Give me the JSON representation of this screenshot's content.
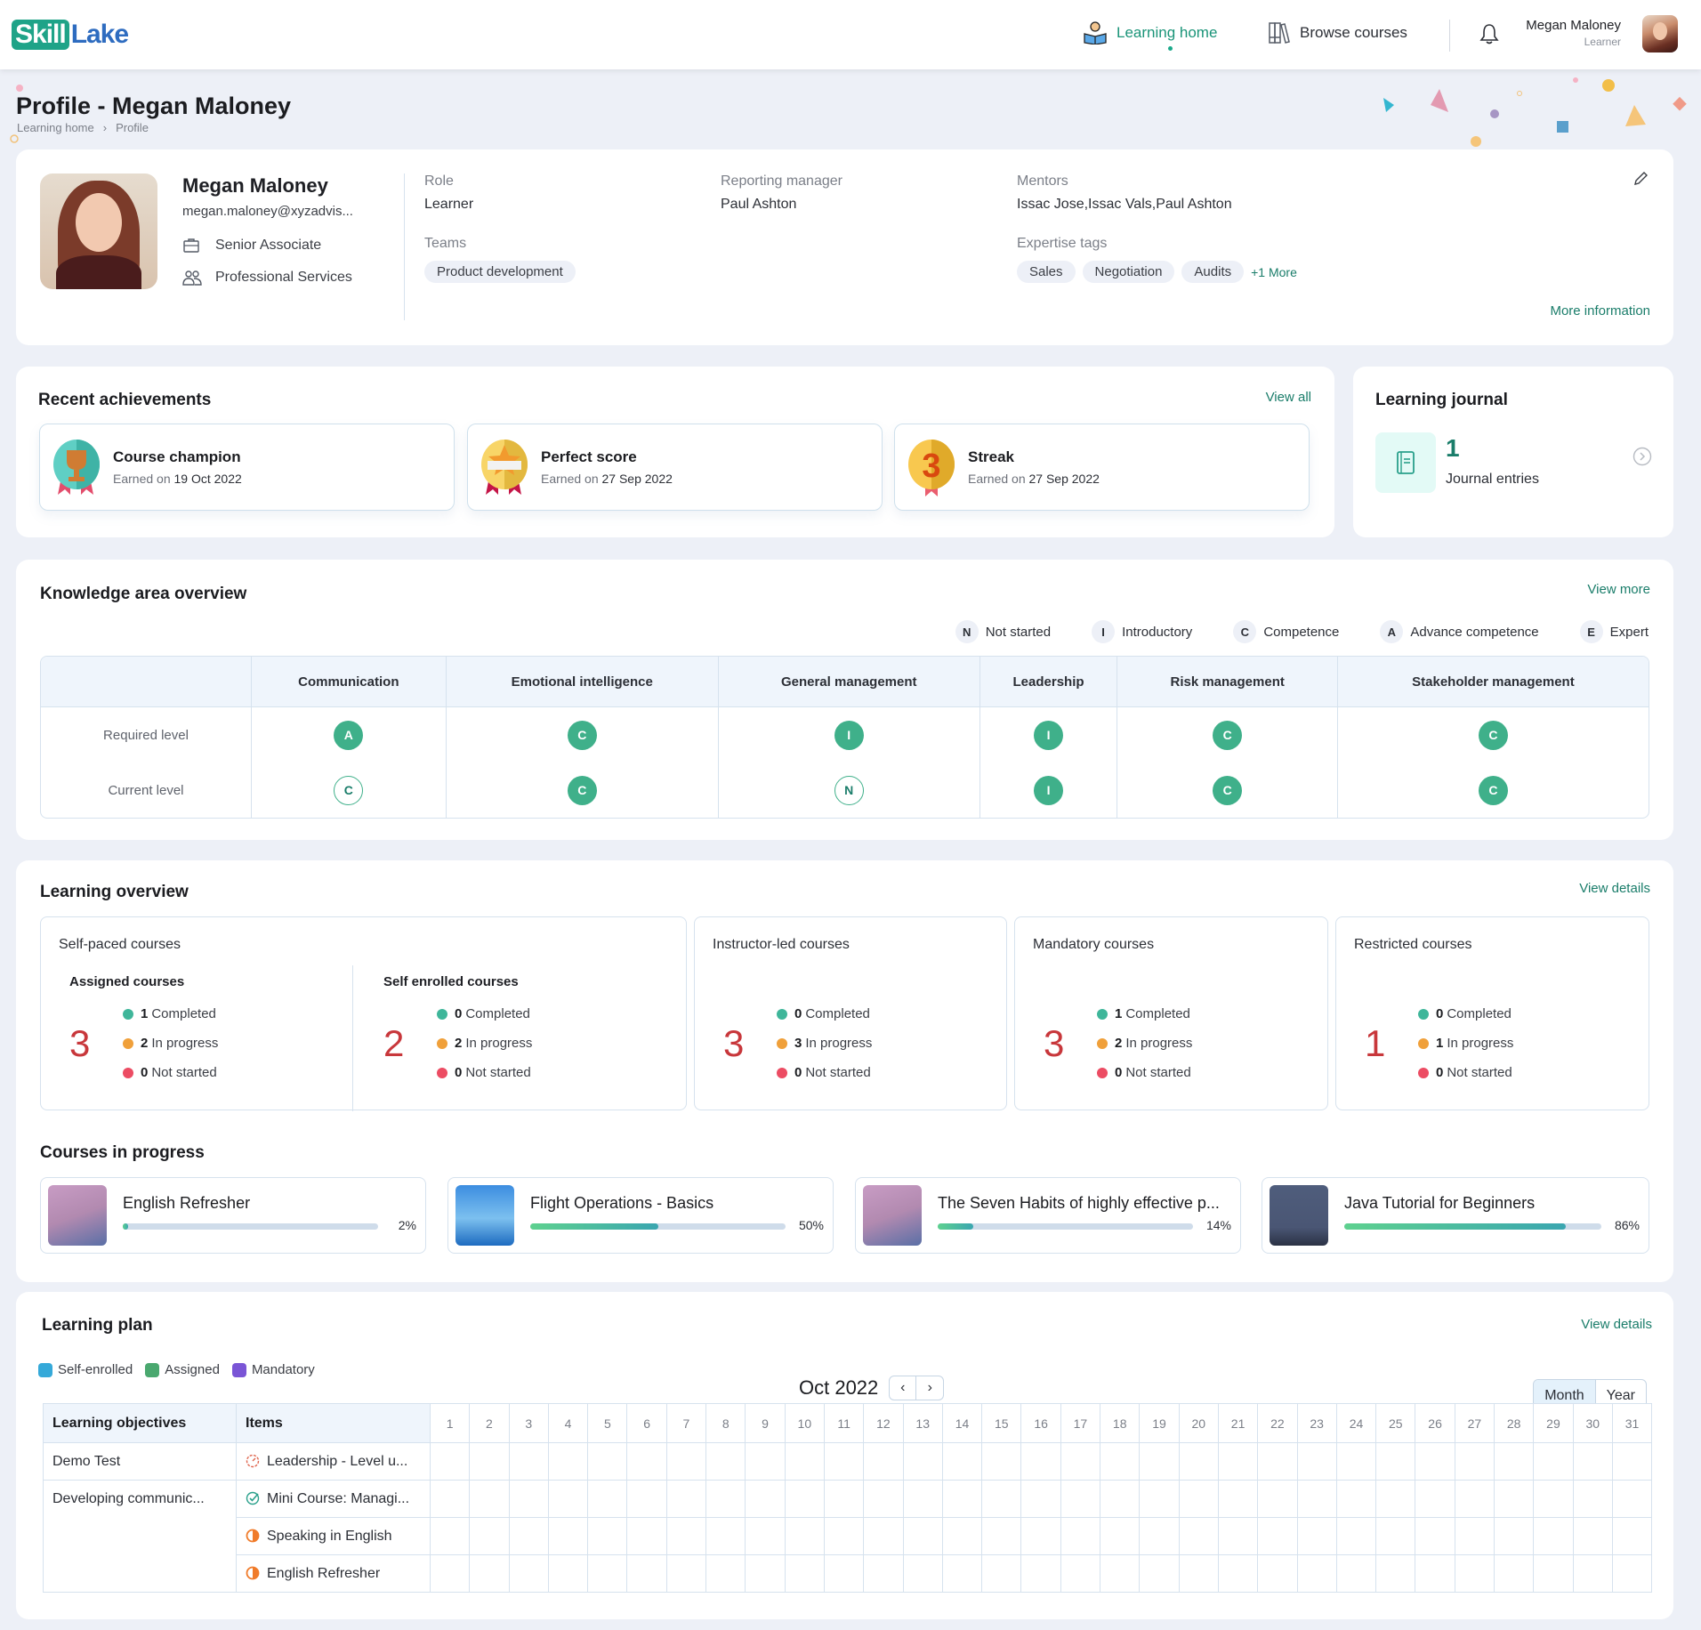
{
  "header": {
    "logo_part1": "Skill",
    "logo_part2": "Lake",
    "nav": [
      {
        "label": "Learning home",
        "icon": "reading-person-icon",
        "active": true
      },
      {
        "label": "Browse courses",
        "icon": "books-icon",
        "active": false
      }
    ],
    "user_name": "Megan Maloney",
    "user_role": "Learner"
  },
  "page": {
    "title": "Profile - Megan Maloney",
    "breadcrumb": [
      "Learning home",
      "Profile"
    ],
    "breadcrumb_separator": "›"
  },
  "profile": {
    "name": "Megan Maloney",
    "email": "megan.maloney@xyzadvis...",
    "designation": "Senior Associate",
    "department": "Professional Services",
    "role_label": "Role",
    "role_value": "Learner",
    "manager_label": "Reporting manager",
    "manager_value": "Paul Ashton",
    "mentors_label": "Mentors",
    "mentors_value": "Issac Jose,Issac Vals,Paul Ashton",
    "teams_label": "Teams",
    "teams": [
      "Product development"
    ],
    "expertise_label": "Expertise tags",
    "expertise": [
      "Sales",
      "Negotiation",
      "Audits"
    ],
    "expertise_more": "+1 More",
    "more_info": "More information"
  },
  "achievements": {
    "title": "Recent achievements",
    "view_all": "View all",
    "earned_prefix": "Earned on",
    "items": [
      {
        "title": "Course champion",
        "date": "19 Oct 2022",
        "badge": "trophy"
      },
      {
        "title": "Perfect score",
        "date": "27 Sep 2022",
        "badge": "star"
      },
      {
        "title": "Streak",
        "date": "27 Sep 2022",
        "badge": "streak-3"
      }
    ]
  },
  "journal": {
    "title": "Learning journal",
    "count": "1",
    "label": "Journal entries"
  },
  "knowledge": {
    "title": "Knowledge area overview",
    "view_more": "View more",
    "legend": [
      {
        "code": "N",
        "label": "Not started"
      },
      {
        "code": "I",
        "label": "Introductory"
      },
      {
        "code": "C",
        "label": "Competence"
      },
      {
        "code": "A",
        "label": "Advance competence"
      },
      {
        "code": "E",
        "label": "Expert"
      }
    ],
    "columns": [
      "Communication",
      "Emotional intelligence",
      "General management",
      "Leadership",
      "Risk management",
      "Stakeholder management"
    ],
    "rows": [
      {
        "label": "Required level",
        "levels": [
          "A",
          "C",
          "I",
          "I",
          "C",
          "C"
        ],
        "filled": [
          true,
          true,
          true,
          true,
          true,
          true
        ]
      },
      {
        "label": "Current level",
        "levels": [
          "C",
          "C",
          "N",
          "I",
          "C",
          "C"
        ],
        "filled": [
          false,
          true,
          false,
          true,
          true,
          true
        ]
      }
    ]
  },
  "overview": {
    "title": "Learning overview",
    "view_details": "View details",
    "labels": {
      "completed": "Completed",
      "in_progress": "In progress",
      "not_started": "Not started"
    },
    "colors": {
      "completed": "#3fb69a",
      "in_progress": "#f0a03a",
      "not_started": "#ec4c63"
    },
    "self_paced": {
      "title": "Self-paced courses",
      "assigned": {
        "title": "Assigned courses",
        "total": "3",
        "completed": "1",
        "in_progress": "2",
        "not_started": "0"
      },
      "self_enrolled": {
        "title": "Self enrolled courses",
        "total": "2",
        "completed": "0",
        "in_progress": "2",
        "not_started": "0"
      }
    },
    "instructor_led": {
      "title": "Instructor-led courses",
      "total": "3",
      "completed": "0",
      "in_progress": "3",
      "not_started": "0"
    },
    "mandatory": {
      "title": "Mandatory courses",
      "total": "3",
      "completed": "1",
      "in_progress": "2",
      "not_started": "0"
    },
    "restricted": {
      "title": "Restricted courses",
      "total": "1",
      "completed": "0",
      "in_progress": "1",
      "not_started": "0"
    }
  },
  "courses_in_progress": {
    "title": "Courses in progress",
    "items": [
      {
        "name": "English Refresher",
        "progress": 2,
        "progress_label": "2%",
        "thumb": "megaphone-man"
      },
      {
        "name": "Flight Operations - Basics",
        "progress": 50,
        "progress_label": "50%",
        "thumb": "airplane"
      },
      {
        "name": "The Seven Habits of highly effective p...",
        "progress": 14,
        "progress_label": "14%",
        "thumb": "megaphone-man"
      },
      {
        "name": "Java Tutorial for Beginners",
        "progress": 86,
        "progress_label": "86%",
        "thumb": "coder-woman"
      }
    ]
  },
  "learning_plan": {
    "title": "Learning plan",
    "view_details": "View details",
    "legend": [
      {
        "label": "Self-enrolled",
        "color": "#35a9d9"
      },
      {
        "label": "Assigned",
        "color": "#4aa86f"
      },
      {
        "label": "Mandatory",
        "color": "#7a55d6"
      }
    ],
    "month": "Oct 2022",
    "prev": "‹",
    "next": "›",
    "views": [
      "Month",
      "Year"
    ],
    "active_view": "Month",
    "col_objectives": "Learning objectives",
    "col_items": "Items",
    "days": [
      "1",
      "2",
      "3",
      "4",
      "5",
      "6",
      "7",
      "8",
      "9",
      "10",
      "11",
      "12",
      "13",
      "14",
      "15",
      "16",
      "17",
      "18",
      "19",
      "20",
      "21",
      "22",
      "23",
      "24",
      "25",
      "26",
      "27",
      "28",
      "29",
      "30",
      "31"
    ],
    "rows": [
      {
        "objective": "Demo Test",
        "item": "Leadership - Level u...",
        "status": "assessment"
      },
      {
        "objective": "Developing communic...",
        "item": "Mini Course: Managi...",
        "status": "completed"
      },
      {
        "objective": "",
        "item": "Speaking in English",
        "status": "in-progress"
      },
      {
        "objective": "",
        "item": "English Refresher",
        "status": "in-progress"
      }
    ]
  }
}
